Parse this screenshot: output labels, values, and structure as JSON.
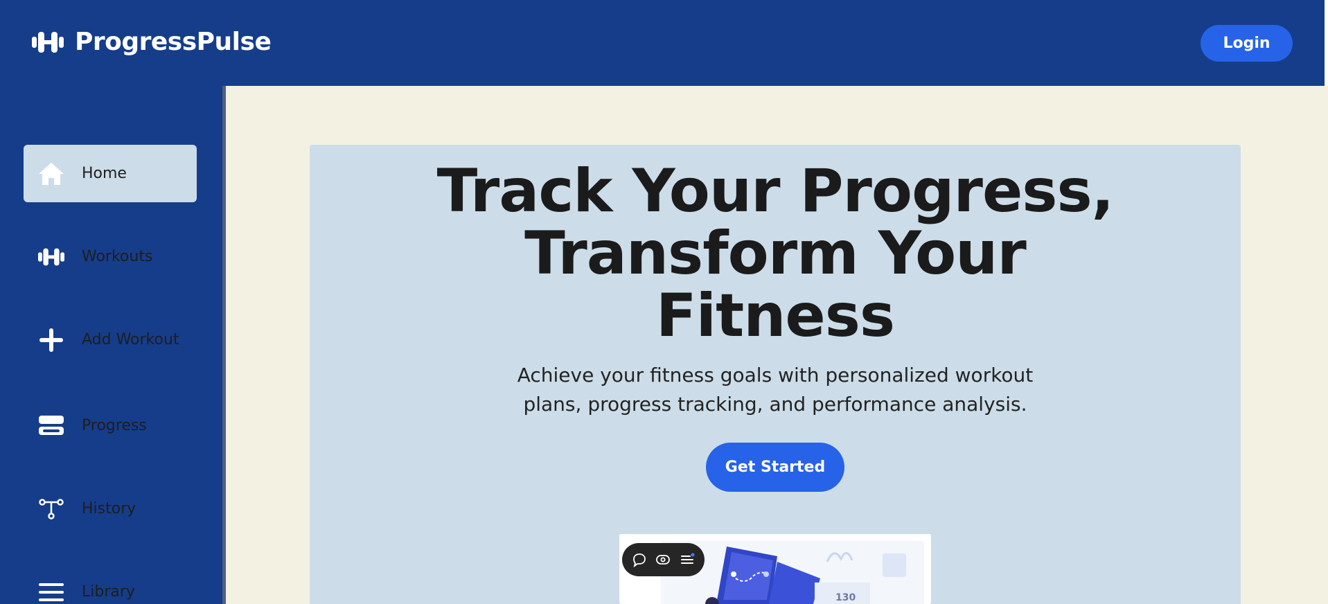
{
  "app": {
    "name": "ProgressPulse",
    "brand_icon": "dumbbell-icon"
  },
  "header": {
    "login_label": "Login"
  },
  "sidebar": {
    "items": [
      {
        "label": "Home",
        "icon": "home-icon",
        "active": true
      },
      {
        "label": "Workouts",
        "icon": "dumbbell-icon",
        "active": false
      },
      {
        "label": "Add Workout",
        "icon": "plus-icon",
        "active": false
      },
      {
        "label": "Progress",
        "icon": "server-icon",
        "active": false
      },
      {
        "label": "History",
        "icon": "branch-icon",
        "active": false
      },
      {
        "label": "Library",
        "icon": "menu-icon",
        "active": false
      }
    ]
  },
  "hero": {
    "title_lines": [
      "Track Your Progress,",
      "Transform Your",
      "Fitness"
    ],
    "subtitle_lines": [
      "Achieve your fitness goals with personalized workout",
      "plans, progress tracking, and performance analysis."
    ],
    "cta_label": "Get Started"
  },
  "preview": {
    "chart_value": "130"
  },
  "floating_toolbar": {
    "buttons": [
      "comment-icon",
      "eye-icon",
      "list-icon"
    ]
  },
  "colors": {
    "primary": "#153d8a",
    "accent": "#2663e8",
    "hero_bg": "#ccdde9",
    "page_bg": "#f3f2e2"
  }
}
